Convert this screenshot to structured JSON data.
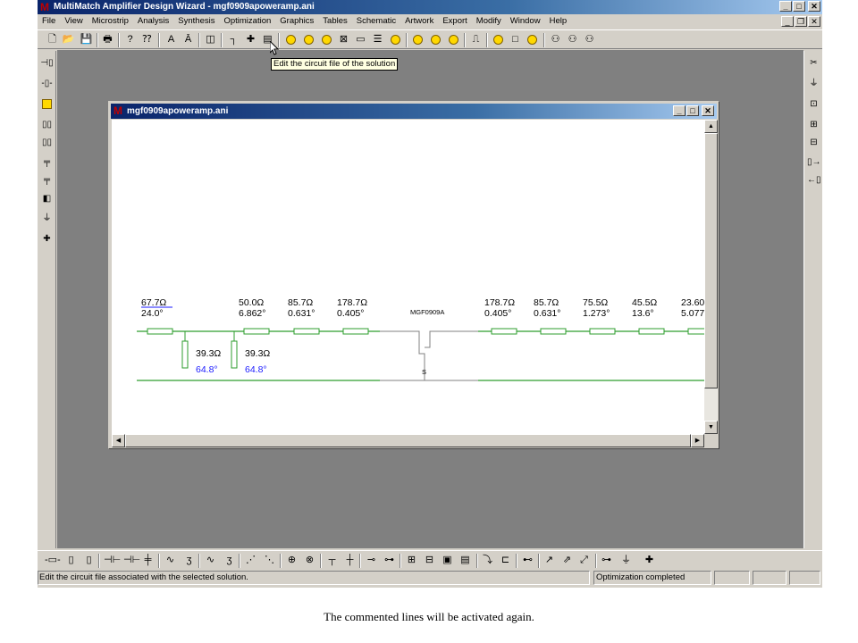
{
  "app": {
    "title": "MultiMatch Amplifier Design Wizard - mgf0909apoweramp.ani",
    "menu": [
      "File",
      "View",
      "Microstrip",
      "Analysis",
      "Synthesis",
      "Optimization",
      "Graphics",
      "Tables",
      "Schematic",
      "Artwork",
      "Export",
      "Modify",
      "Window",
      "Help"
    ]
  },
  "tooltip": "Edit the circuit file of the solution",
  "child": {
    "title": "mgf0909apoweramp.ani"
  },
  "schematic": {
    "top_labels": [
      {
        "z": "67.7Ω",
        "deg": "24.0°"
      },
      {
        "z": "50.0Ω",
        "deg": "6.862°"
      },
      {
        "z": "85.7Ω",
        "deg": "0.631°"
      },
      {
        "z": "178.7Ω",
        "deg": "0.405°"
      },
      {
        "z": "178.7Ω",
        "deg": "0.405°"
      },
      {
        "z": "85.7Ω",
        "deg": "0.631°"
      },
      {
        "z": "75.5Ω",
        "deg": "1.273°"
      },
      {
        "z": "45.5Ω",
        "deg": "13.6°"
      },
      {
        "z": "23.60",
        "deg": "5.077"
      }
    ],
    "stubs": [
      {
        "z": "39.3Ω",
        "deg": "64.8°"
      },
      {
        "z": "39.3Ω",
        "deg": "64.8°"
      }
    ],
    "device": "MGF0909A",
    "source_label": "S",
    "line_color": "#2e9e2e",
    "blue_text_color": "#1a1aff"
  },
  "status": {
    "main": "Edit the circuit file associated with the selected solution.",
    "right": "Optimization completed"
  },
  "caption": "The commented lines will be activated again."
}
